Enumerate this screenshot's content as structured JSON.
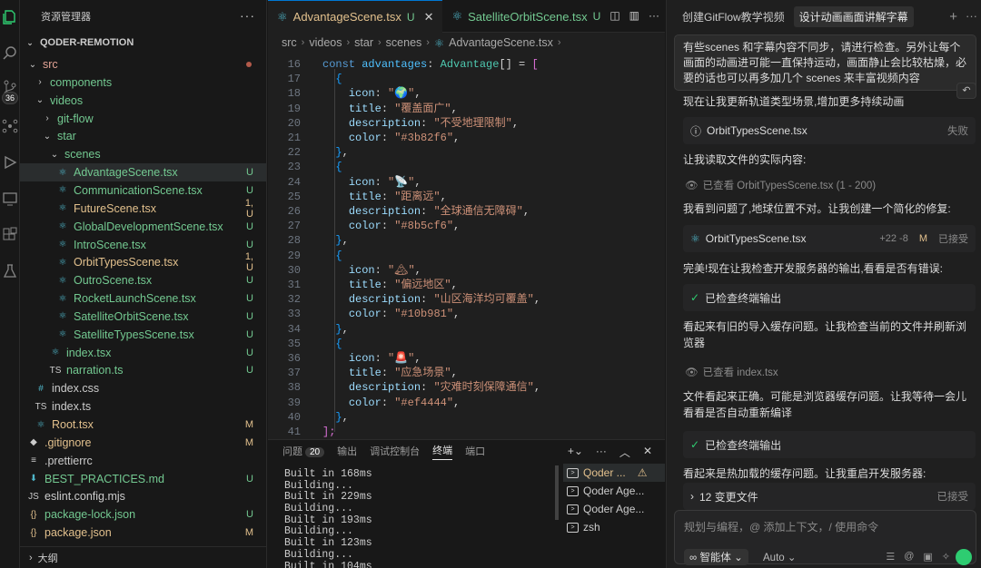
{
  "explorer": {
    "title": "资源管理器",
    "more": "···",
    "project": "QODER-REMOTION",
    "outline": "大纲",
    "items": [
      {
        "name": "src",
        "type": "folder",
        "open": true,
        "depth": 1,
        "status": "dot"
      },
      {
        "name": "components",
        "type": "folder",
        "open": false,
        "depth": 2,
        "status": ""
      },
      {
        "name": "videos",
        "type": "folder",
        "open": true,
        "depth": 2,
        "status": ""
      },
      {
        "name": "git-flow",
        "type": "folder",
        "open": false,
        "depth": 3,
        "status": ""
      },
      {
        "name": "star",
        "type": "folder",
        "open": true,
        "depth": 3,
        "status": ""
      },
      {
        "name": "scenes",
        "type": "folder",
        "open": true,
        "depth": 4,
        "status": ""
      },
      {
        "name": "AdvantageScene.tsx",
        "type": "tsx",
        "depth": 5,
        "status": "U",
        "selected": true
      },
      {
        "name": "CommunicationScene.tsx",
        "type": "tsx",
        "depth": 5,
        "status": "U"
      },
      {
        "name": "FutureScene.tsx",
        "type": "tsx",
        "depth": 5,
        "status": "1, U",
        "warn": true
      },
      {
        "name": "GlobalDevelopmentScene.tsx",
        "type": "tsx",
        "depth": 5,
        "status": "U"
      },
      {
        "name": "IntroScene.tsx",
        "type": "tsx",
        "depth": 5,
        "status": "U"
      },
      {
        "name": "OrbitTypesScene.tsx",
        "type": "tsx",
        "depth": 5,
        "status": "1, U",
        "warn": true
      },
      {
        "name": "OutroScene.tsx",
        "type": "tsx",
        "depth": 5,
        "status": "U"
      },
      {
        "name": "RocketLaunchScene.tsx",
        "type": "tsx",
        "depth": 5,
        "status": "U"
      },
      {
        "name": "SatelliteOrbitScene.tsx",
        "type": "tsx",
        "depth": 5,
        "status": "U"
      },
      {
        "name": "SatelliteTypesScene.tsx",
        "type": "tsx",
        "depth": 5,
        "status": "U"
      },
      {
        "name": "index.tsx",
        "type": "tsx",
        "depth": 4,
        "status": "U"
      },
      {
        "name": "narration.ts",
        "type": "ts",
        "depth": 4,
        "status": "U"
      },
      {
        "name": "index.css",
        "type": "css",
        "depth": 2,
        "status": ""
      },
      {
        "name": "index.ts",
        "type": "ts",
        "depth": 2,
        "status": ""
      },
      {
        "name": "Root.tsx",
        "type": "tsx",
        "depth": 2,
        "status": "M",
        "mod": true
      },
      {
        "name": ".gitignore",
        "type": "git",
        "depth": 1,
        "status": "M",
        "mod": true
      },
      {
        "name": ".prettierrc",
        "type": "cfg",
        "depth": 1,
        "status": ""
      },
      {
        "name": "BEST_PRACTICES.md",
        "type": "md",
        "depth": 1,
        "status": "U"
      },
      {
        "name": "eslint.config.mjs",
        "type": "js",
        "depth": 1,
        "status": ""
      },
      {
        "name": "package-lock.json",
        "type": "json",
        "depth": 1,
        "status": "U"
      },
      {
        "name": "package.json",
        "type": "json",
        "depth": 1,
        "status": "M",
        "mod": true
      }
    ]
  },
  "editor": {
    "tabs": [
      {
        "label": "AdvantageScene.tsx",
        "status": "U",
        "active": true
      },
      {
        "label": "SatelliteOrbitScene.tsx",
        "status": "U",
        "active": false
      }
    ],
    "breadcrumb": [
      "src",
      "videos",
      "star",
      "scenes",
      "AdvantageScene.tsx"
    ],
    "lines": [
      {
        "n": "16",
        "t": [
          [
            "kw",
            "const "
          ],
          [
            "var",
            "advantages"
          ],
          [
            "pun",
            ": "
          ],
          [
            "type",
            "Advantage"
          ],
          [
            "pun",
            "[] = "
          ],
          [
            "br",
            "["
          ]
        ]
      },
      {
        "n": "17",
        "t": [
          [
            "pun",
            "  "
          ],
          [
            "br2",
            "{"
          ]
        ]
      },
      {
        "n": "18",
        "t": [
          [
            "pun",
            "    "
          ],
          [
            "prop",
            "icon"
          ],
          [
            "pun",
            ": "
          ],
          [
            "str",
            "\"🌍\""
          ],
          [
            "pun",
            ","
          ]
        ]
      },
      {
        "n": "19",
        "t": [
          [
            "pun",
            "    "
          ],
          [
            "prop",
            "title"
          ],
          [
            "pun",
            ": "
          ],
          [
            "str",
            "\"覆盖面广\""
          ],
          [
            "pun",
            ","
          ]
        ]
      },
      {
        "n": "20",
        "t": [
          [
            "pun",
            "    "
          ],
          [
            "prop",
            "description"
          ],
          [
            "pun",
            ": "
          ],
          [
            "str",
            "\"不受地理限制\""
          ],
          [
            "pun",
            ","
          ]
        ]
      },
      {
        "n": "21",
        "t": [
          [
            "pun",
            "    "
          ],
          [
            "prop",
            "color"
          ],
          [
            "pun",
            ": "
          ],
          [
            "str",
            "\"#3b82f6\""
          ],
          [
            "pun",
            ","
          ]
        ]
      },
      {
        "n": "22",
        "t": [
          [
            "pun",
            "  "
          ],
          [
            "br2",
            "}"
          ],
          [
            "pun",
            ","
          ]
        ]
      },
      {
        "n": "23",
        "t": [
          [
            "pun",
            "  "
          ],
          [
            "br2",
            "{"
          ]
        ]
      },
      {
        "n": "24",
        "t": [
          [
            "pun",
            "    "
          ],
          [
            "prop",
            "icon"
          ],
          [
            "pun",
            ": "
          ],
          [
            "str",
            "\"📡\""
          ],
          [
            "pun",
            ","
          ]
        ]
      },
      {
        "n": "25",
        "t": [
          [
            "pun",
            "    "
          ],
          [
            "prop",
            "title"
          ],
          [
            "pun",
            ": "
          ],
          [
            "str",
            "\"距离远\""
          ],
          [
            "pun",
            ","
          ]
        ]
      },
      {
        "n": "26",
        "t": [
          [
            "pun",
            "    "
          ],
          [
            "prop",
            "description"
          ],
          [
            "pun",
            ": "
          ],
          [
            "str",
            "\"全球通信无障碍\""
          ],
          [
            "pun",
            ","
          ]
        ]
      },
      {
        "n": "27",
        "t": [
          [
            "pun",
            "    "
          ],
          [
            "prop",
            "color"
          ],
          [
            "pun",
            ": "
          ],
          [
            "str",
            "\"#8b5cf6\""
          ],
          [
            "pun",
            ","
          ]
        ]
      },
      {
        "n": "28",
        "t": [
          [
            "pun",
            "  "
          ],
          [
            "br2",
            "}"
          ],
          [
            "pun",
            ","
          ]
        ]
      },
      {
        "n": "29",
        "t": [
          [
            "pun",
            "  "
          ],
          [
            "br2",
            "{"
          ]
        ]
      },
      {
        "n": "30",
        "t": [
          [
            "pun",
            "    "
          ],
          [
            "prop",
            "icon"
          ],
          [
            "pun",
            ": "
          ],
          [
            "str",
            "\"🏔\""
          ],
          [
            "pun",
            ","
          ]
        ]
      },
      {
        "n": "31",
        "t": [
          [
            "pun",
            "    "
          ],
          [
            "prop",
            "title"
          ],
          [
            "pun",
            ": "
          ],
          [
            "str",
            "\"偏远地区\""
          ],
          [
            "pun",
            ","
          ]
        ]
      },
      {
        "n": "32",
        "t": [
          [
            "pun",
            "    "
          ],
          [
            "prop",
            "description"
          ],
          [
            "pun",
            ": "
          ],
          [
            "str",
            "\"山区海洋均可覆盖\""
          ],
          [
            "pun",
            ","
          ]
        ]
      },
      {
        "n": "33",
        "t": [
          [
            "pun",
            "    "
          ],
          [
            "prop",
            "color"
          ],
          [
            "pun",
            ": "
          ],
          [
            "str",
            "\"#10b981\""
          ],
          [
            "pun",
            ","
          ]
        ]
      },
      {
        "n": "34",
        "t": [
          [
            "pun",
            "  "
          ],
          [
            "br2",
            "}"
          ],
          [
            "pun",
            ","
          ]
        ]
      },
      {
        "n": "35",
        "t": [
          [
            "pun",
            "  "
          ],
          [
            "br2",
            "{"
          ]
        ]
      },
      {
        "n": "36",
        "t": [
          [
            "pun",
            "    "
          ],
          [
            "prop",
            "icon"
          ],
          [
            "pun",
            ": "
          ],
          [
            "str",
            "\"🚨\""
          ],
          [
            "pun",
            ","
          ]
        ]
      },
      {
        "n": "37",
        "t": [
          [
            "pun",
            "    "
          ],
          [
            "prop",
            "title"
          ],
          [
            "pun",
            ": "
          ],
          [
            "str",
            "\"应急场景\""
          ],
          [
            "pun",
            ","
          ]
        ]
      },
      {
        "n": "38",
        "t": [
          [
            "pun",
            "    "
          ],
          [
            "prop",
            "description"
          ],
          [
            "pun",
            ": "
          ],
          [
            "str",
            "\"灾难时刻保障通信\""
          ],
          [
            "pun",
            ","
          ]
        ]
      },
      {
        "n": "39",
        "t": [
          [
            "pun",
            "    "
          ],
          [
            "prop",
            "color"
          ],
          [
            "pun",
            ": "
          ],
          [
            "str",
            "\"#ef4444\""
          ],
          [
            "pun",
            ","
          ]
        ]
      },
      {
        "n": "40",
        "t": [
          [
            "pun",
            "  "
          ],
          [
            "br2",
            "}"
          ],
          [
            "pun",
            ","
          ]
        ]
      },
      {
        "n": "41",
        "t": [
          [
            "br",
            "];"
          ]
        ]
      }
    ]
  },
  "panel": {
    "tabs": [
      {
        "label": "问题",
        "count": "20"
      },
      {
        "label": "输出"
      },
      {
        "label": "调试控制台"
      },
      {
        "label": "终端",
        "active": true
      },
      {
        "label": "端口"
      }
    ],
    "terminal_lines": [
      "Built in 168ms",
      "Building...",
      "Built in 229ms",
      "Building...",
      "Built in 193ms",
      "Building...",
      "Built in 123ms",
      "Building...",
      "Built in 104ms"
    ],
    "terminals": [
      {
        "label": "Qoder ...",
        "warn": true,
        "selected": true
      },
      {
        "label": "Qoder Age..."
      },
      {
        "label": "Qoder Age..."
      },
      {
        "label": "zsh"
      }
    ]
  },
  "chat": {
    "tabs": [
      "创建GitFlow教学视频",
      "设计动画画面讲解字幕"
    ],
    "user_message": "有些scenes 和字幕内容不同步，请进行检查。另外让每个画面的动画进可能一直保持运动，画面静止会比较枯燥，必要的话也可以再多加几个 scenes 来丰富视频内容",
    "m1": "现在让我更新轨道类型场景,增加更多持续动画",
    "card1_file": "OrbitTypesScene.tsx",
    "card1_status": "失败",
    "m2": "让我读取文件的实际内容:",
    "viewed1": "已查看 OrbitTypesScene.tsx (1 - 200)",
    "m3": "我看到问题了,地球位置不对。让我创建一个简化的修复:",
    "card2_file": "OrbitTypesScene.tsx",
    "card2_diff": "+22 -8",
    "card2_m": "M",
    "card2_status": "已接受",
    "m4": "完美!现在让我检查开发服务器的输出,看看是否有错误:",
    "card3": "已检查终端输出",
    "m5": "看起来有旧的导入缓存问题。让我检查当前的文件并刷新浏览器",
    "viewed2": "已查看 index.tsx",
    "m6": "文件看起来正确。可能是浏览器缓存问题。让我等待一会儿看看是否自动重新编译",
    "card4": "已检查终端输出",
    "m7": "看起来是热加载的缓存问题。让我重启开发服务器:",
    "card5": "12 变更文件",
    "card5_status": "已接受",
    "input_placeholder": "规划与编程，@ 添加上下文，/ 使用命令",
    "mode": "智能体",
    "model": "Auto"
  },
  "colors": {
    "accent": "#0078d4",
    "brand": "#2ecc71"
  }
}
